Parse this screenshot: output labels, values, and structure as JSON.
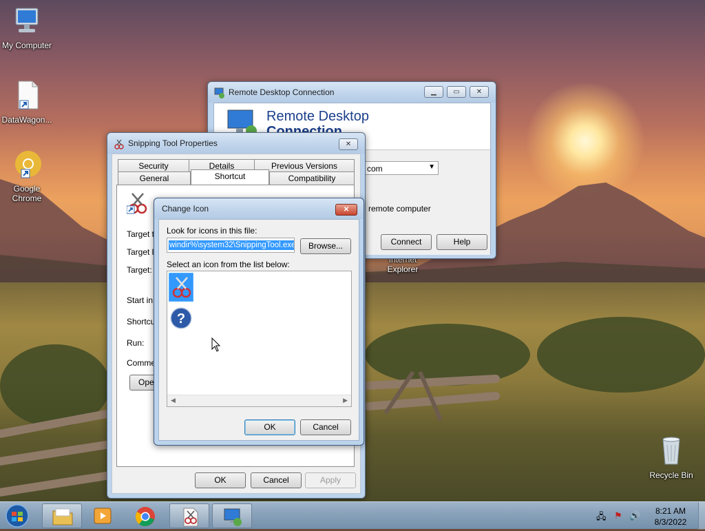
{
  "desktop": {
    "icons": [
      {
        "label": "My Computer"
      },
      {
        "label": "DataWagon..."
      },
      {
        "label": "Google\nChrome"
      },
      {
        "label": "Recycle Bin"
      },
      {
        "label": "Internet\nExplorer"
      }
    ]
  },
  "rdc_window": {
    "title": "Remote Desktop Connection",
    "banner_line1": "Remote Desktop",
    "banner_line2": "Connection",
    "computer_value_fragment": "com",
    "remote_text_fragment": "remote computer",
    "connect_label": "Connect",
    "help_label": "Help"
  },
  "props_window": {
    "title": "Snipping Tool Properties",
    "tabs_row1": [
      "Security",
      "Details",
      "Previous Versions"
    ],
    "tabs_row2": [
      "General",
      "Shortcut",
      "Compatibility"
    ],
    "selected_tab": "Shortcut",
    "fields": [
      "Target ty",
      "Target lo",
      "Target:",
      "Start in:",
      "Shortcut",
      "Run:",
      "Commen"
    ],
    "open_button_fragment": "Ope",
    "ok_label": "OK",
    "cancel_label": "Cancel",
    "apply_label": "Apply"
  },
  "change_icon": {
    "title": "Change Icon",
    "look_label": "Look for icons in this file:",
    "file_value": "windir%\\system32\\SnippingTool.exe",
    "browse_label": "Browse...",
    "list_label": "Select an icon from the list below:",
    "icons": [
      "snipping-tool-icon",
      "help-icon"
    ],
    "ok_label": "OK",
    "cancel_label": "Cancel"
  },
  "taskbar": {
    "items": [
      "start-orb",
      "explorer-icon",
      "media-player-icon",
      "chrome-icon",
      "snipping-properties-icon",
      "remote-desktop-icon"
    ],
    "time": "8:21 AM",
    "date": "8/3/2022"
  },
  "colors": {
    "selection": "#3399ff",
    "close_button": "#c8452f"
  }
}
